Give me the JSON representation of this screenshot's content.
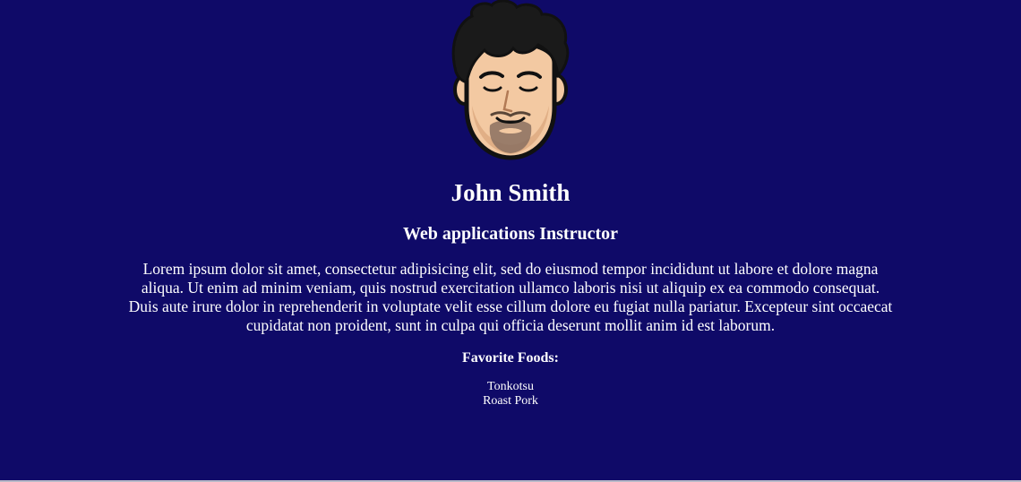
{
  "profile": {
    "avatar_icon": "cartoon-man-avatar",
    "name": "John Smith",
    "role": "Web applications Instructor",
    "bio": "Lorem ipsum dolor sit amet, consectetur adipisicing elit, sed do eiusmod tempor incididunt ut labore et dolore magna aliqua. Ut enim ad minim veniam, quis nostrud exercitation ullamco laboris nisi ut aliquip ex ea commodo consequat. Duis aute irure dolor in reprehenderit in voluptate velit esse cillum dolore eu fugiat nulla pariatur. Excepteur sint occaecat cupidatat non proident, sunt in culpa qui officia deserunt mollit anim id est laborum."
  },
  "favorites": {
    "heading": "Favorite Foods:",
    "items": [
      "Tonkotsu",
      "Roast Pork"
    ]
  },
  "colors": {
    "background": "#0f0a68",
    "text": "#ffffff"
  }
}
